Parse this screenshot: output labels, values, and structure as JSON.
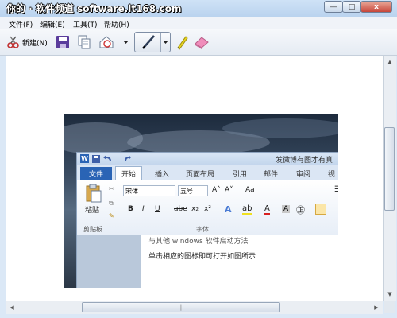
{
  "window": {
    "title": "你的 · 软件频道 software.it168.com",
    "buttons": {
      "minimize": "—",
      "maximize": "□",
      "close": "x"
    }
  },
  "menu": [
    "文件(F)",
    "编辑(E)",
    "工具(T)",
    "帮助(H)"
  ],
  "toolbar": {
    "new_label": "新建(N)",
    "icons": [
      "snip-scissors-icon",
      "save-icon",
      "copy-icon",
      "send-icon",
      "pen-icon",
      "highlighter-icon",
      "eraser-icon"
    ]
  },
  "screenshot": {
    "title": "发微博有图才有真",
    "tabs": {
      "file": "文件",
      "home": "开始",
      "insert": "插入",
      "layout": "页面布局",
      "refs": "引用",
      "mail": "邮件",
      "review": "审阅",
      "view": "视"
    },
    "paste": "粘贴",
    "clipboard": "剪贴板",
    "font_name": "宋体",
    "font_size": "五号",
    "font_group": "字体",
    "fmt_buttons": {
      "bold": "B",
      "italic": "I",
      "underline": "U",
      "strike": "abe",
      "sub": "x₂",
      "sup": "x²",
      "case": "Aa",
      "grow": "A˄",
      "shrink": "A˅"
    },
    "doc_line1": "与其他 windows 软件启动方法",
    "doc_line2": "单击相应的图标即可打开如图所示"
  },
  "scrollbar": {
    "thumb_grip": "|||"
  },
  "colors": {
    "accent": "#2a64b5",
    "close": "#c7463a"
  }
}
